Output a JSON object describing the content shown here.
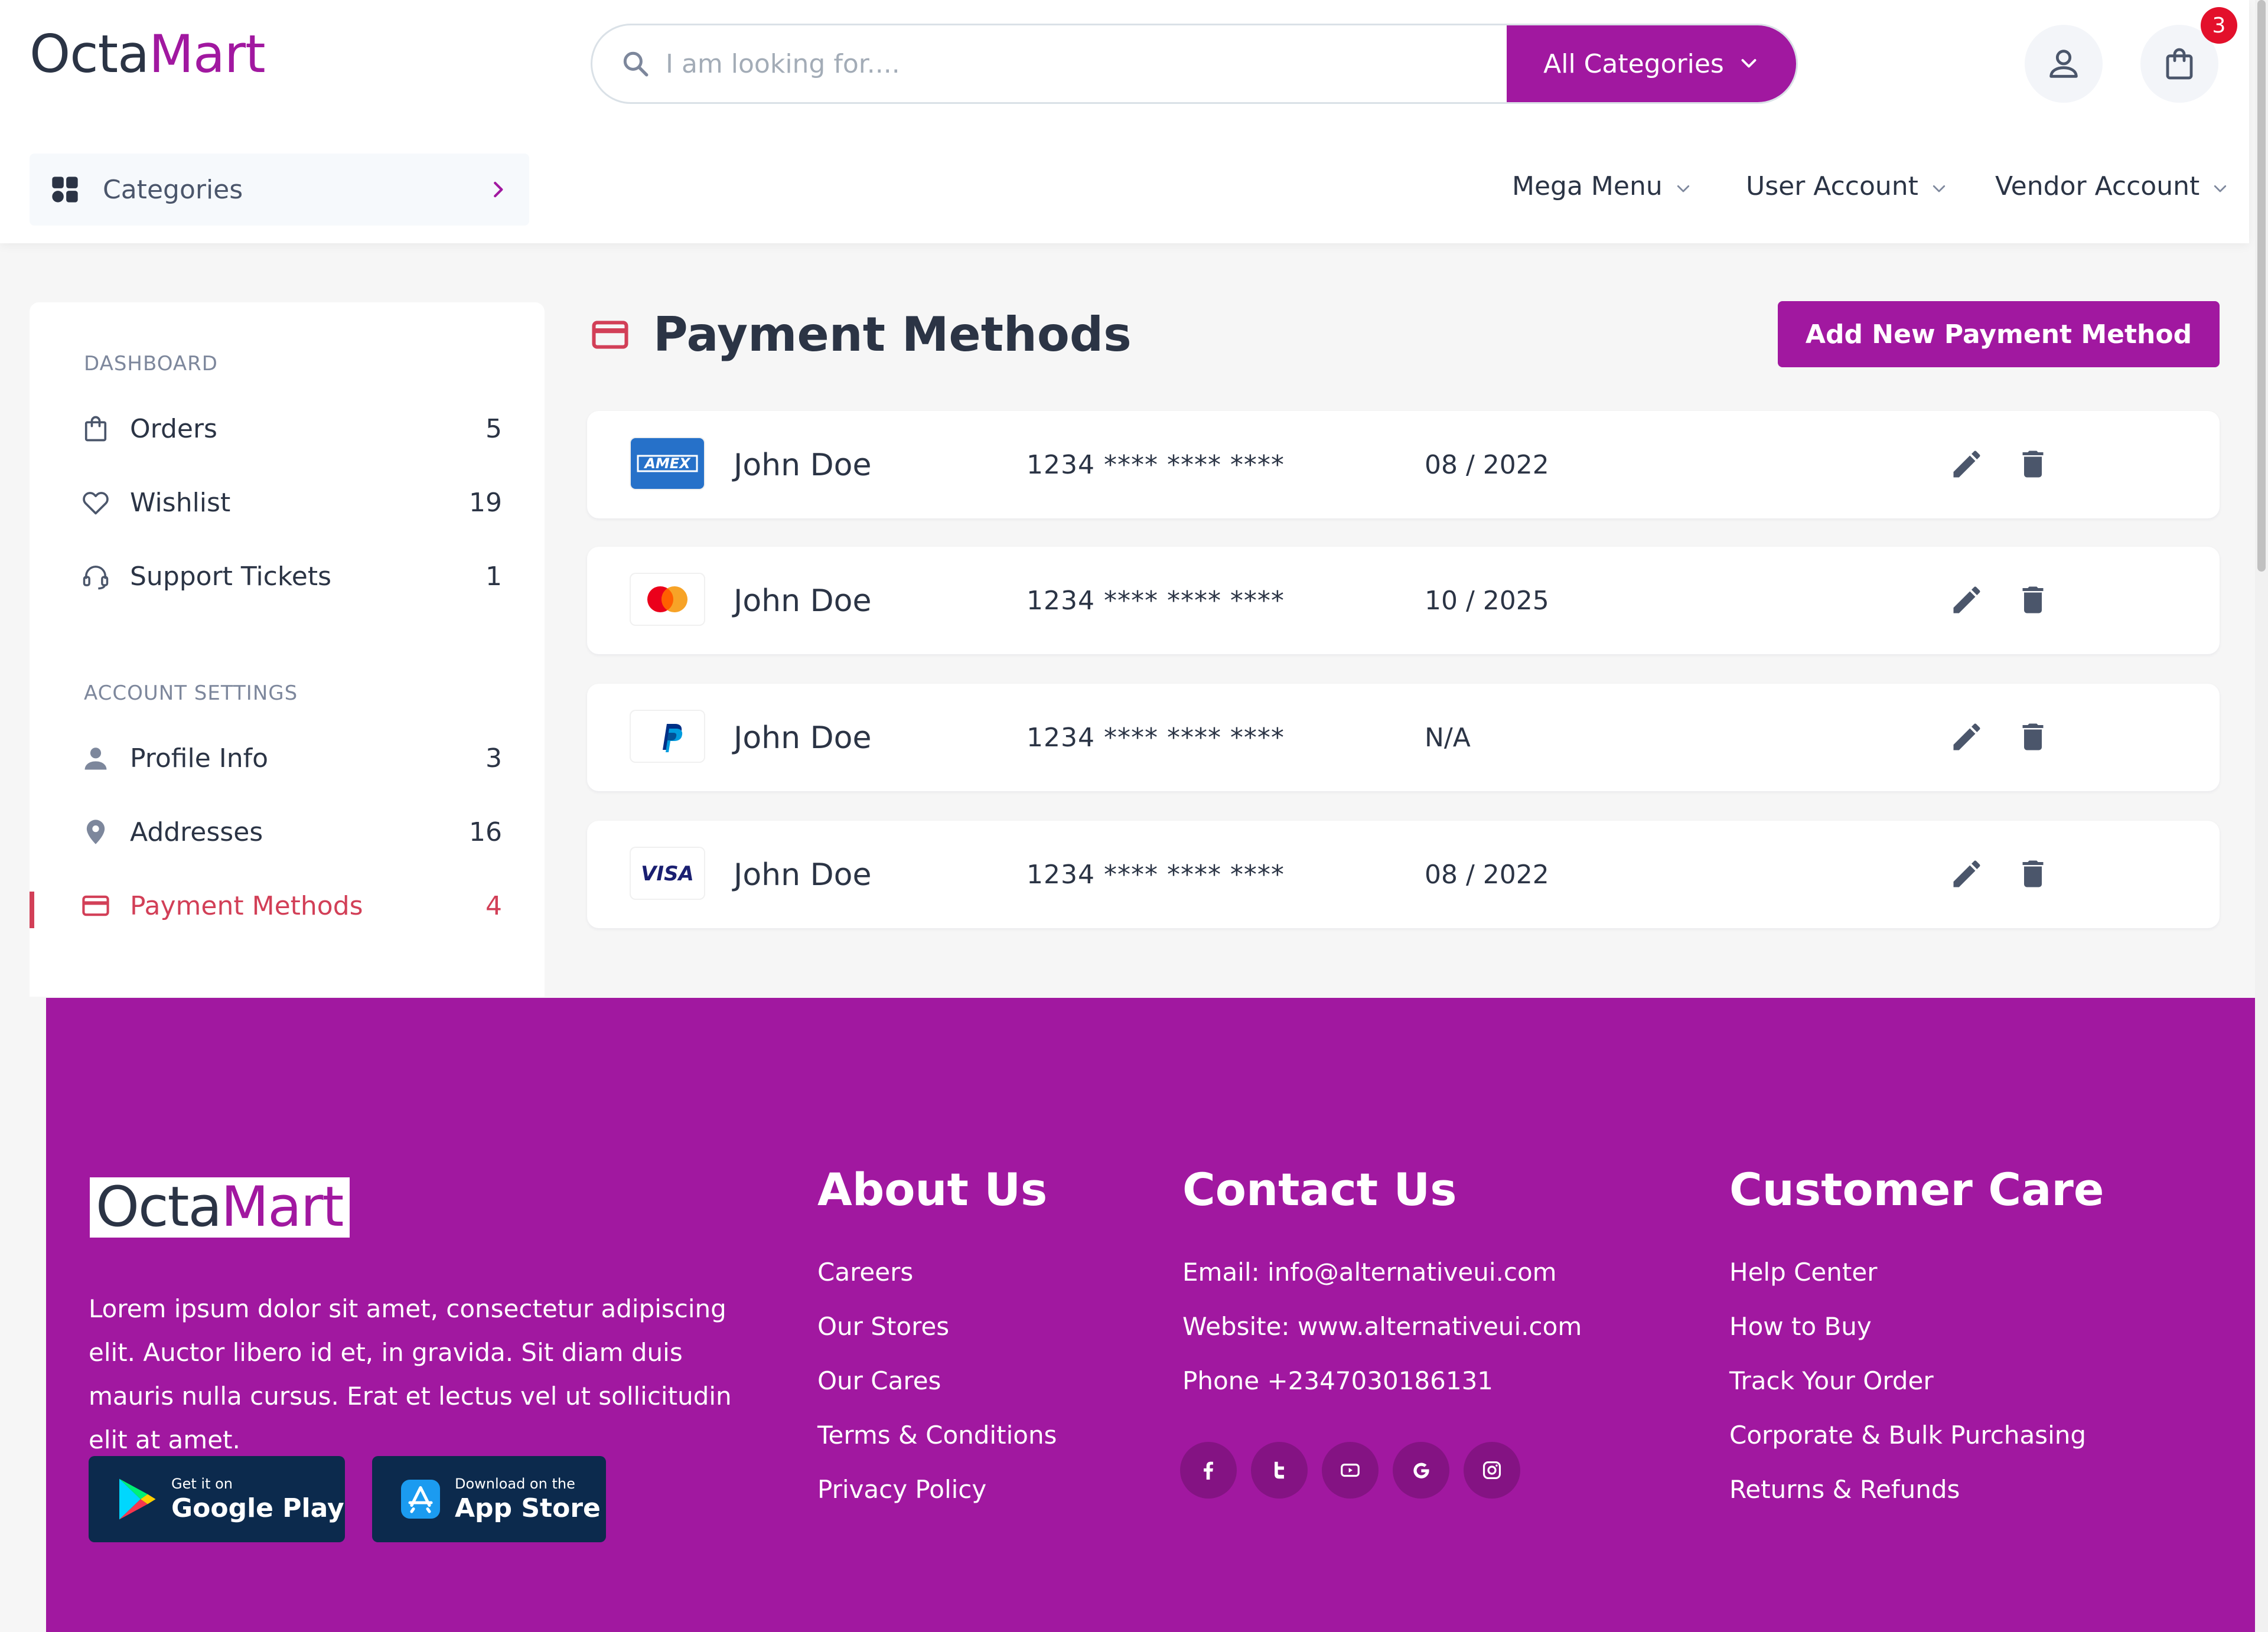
{
  "header": {
    "logo_part1": "Octa",
    "logo_part2": "Mart",
    "search_placeholder": "I am looking for....",
    "category_button": "All Categories",
    "cart_count": "3",
    "categories_label": "Categories",
    "nav": [
      {
        "label": "Mega Menu"
      },
      {
        "label": "User Account"
      },
      {
        "label": "Vendor Account"
      }
    ]
  },
  "sidebar": {
    "dashboard_heading": "DASHBOARD",
    "dashboard_items": [
      {
        "label": "Orders",
        "count": "5",
        "icon": "bag-icon"
      },
      {
        "label": "Wishlist",
        "count": "19",
        "icon": "heart-icon"
      },
      {
        "label": "Support Tickets",
        "count": "1",
        "icon": "headset-icon"
      }
    ],
    "account_heading": "ACCOUNT SETTINGS",
    "account_items": [
      {
        "label": "Profile Info",
        "count": "3",
        "icon": "person-icon"
      },
      {
        "label": "Addresses",
        "count": "16",
        "icon": "location-pin-icon"
      },
      {
        "label": "Payment Methods",
        "count": "4",
        "icon": "credit-card-icon",
        "active": true
      }
    ]
  },
  "main": {
    "title": "Payment Methods",
    "add_button": "Add New Payment Method",
    "cards": [
      {
        "brand": "amex-logo-icon",
        "name": "John Doe",
        "number": "1234 **** **** ****",
        "expiry": "08 / 2022"
      },
      {
        "brand": "mastercard-logo-icon",
        "name": "John Doe",
        "number": "1234 **** **** ****",
        "expiry": "10 / 2025"
      },
      {
        "brand": "paypal-logo-icon",
        "name": "John Doe",
        "number": "1234 **** **** ****",
        "expiry": "N/A"
      },
      {
        "brand": "visa-logo-icon",
        "name": "John Doe",
        "number": "1234 **** **** ****",
        "expiry": "08 / 2022"
      }
    ],
    "amex_text": "AMEX",
    "visa_text": "VISA"
  },
  "footer": {
    "logo_part1": "Octa",
    "logo_part2": "Mart",
    "description": "Lorem ipsum dolor sit amet, consectetur adipiscing elit. Auctor libero id et, in gravida. Sit diam duis mauris nulla cursus. Erat et lectus vel ut sollicitudin elit at amet.",
    "google_play": {
      "small": "Get it on",
      "big": "Google Play"
    },
    "app_store": {
      "small": "Download on the",
      "big": "App Store"
    },
    "about": {
      "title": "About Us",
      "links": [
        "Careers",
        "Our Stores",
        "Our Cares",
        "Terms & Conditions",
        "Privacy Policy"
      ]
    },
    "contact": {
      "title": "Contact Us",
      "lines": [
        "Email: info@alternativeui.com",
        "Website: www.alternativeui.com",
        "Phone +2347030186131"
      ],
      "social": [
        "facebook-icon",
        "twitter-icon",
        "youtube-icon",
        "google-icon",
        "instagram-icon"
      ]
    },
    "care": {
      "title": "Customer Care",
      "links": [
        "Help Center",
        "How to Buy",
        "Track Your Order",
        "Corporate & Bulk Purchasing",
        "Returns & Refunds"
      ]
    }
  },
  "colors": {
    "brand": "#a118a0",
    "active": "#d23f57",
    "badge": "#e3102b",
    "text": "#2b3445"
  }
}
